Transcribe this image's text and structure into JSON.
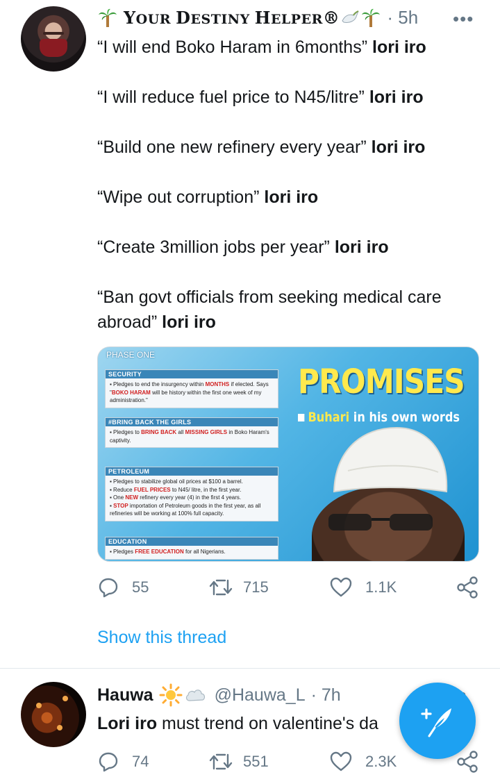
{
  "tweet1": {
    "display_name_parts": [
      {
        "big": "Y",
        "small": "OUR "
      },
      {
        "big": "D",
        "small": "ESTINY "
      },
      {
        "big": "H",
        "small": "ELPER"
      }
    ],
    "reg_mark": "®",
    "time": "· 5h",
    "more": "•••",
    "lines": [
      {
        "quote": "“I will end Boko Haram in 6months”",
        "tag": "lori iro"
      },
      {
        "quote": "“I will reduce fuel price to N45/litre”",
        "tag": "lori iro"
      },
      {
        "quote": "“Build one new refinery every year”",
        "tag": "lori iro"
      },
      {
        "quote": "“Wipe out corruption”",
        "tag": "lori iro"
      },
      {
        "quote": "“Create 3million jobs per year”",
        "tag": "lori iro"
      },
      {
        "quote": "“Ban govt officials from seeking medical care abroad”",
        "tag": "lori iro"
      }
    ],
    "media": {
      "phase": "PHASE ONE",
      "title": "PROMISES",
      "subtitle_name": "Buhari",
      "subtitle_rest": " in his own words",
      "panels": [
        {
          "heading": "SECURITY",
          "body": [
            {
              "t": "▪ Pledges to end the insurgency within "
            },
            {
              "t": "MONTHS",
              "red": true
            },
            {
              "t": " if elected. Says \""
            },
            {
              "t": "BOKO HARAM",
              "red": true
            },
            {
              "t": " will be history within the first one week of my administration.\""
            }
          ]
        },
        {
          "heading": "#BRING BACK THE GIRLS",
          "body": [
            {
              "t": "▪ Pledges to "
            },
            {
              "t": "BRING BACK",
              "red": true
            },
            {
              "t": " all "
            },
            {
              "t": "MISSING GIRLS",
              "red": true
            },
            {
              "t": " in Boko Haram's captivity."
            }
          ]
        },
        {
          "heading": "PETROLEUM",
          "body": [
            {
              "t": "▪ Pledges to stabilize global oil prices at $100 a barrel."
            },
            {
              "br": true
            },
            {
              "t": "▪ Reduce "
            },
            {
              "t": "FUEL PRICES",
              "red": true
            },
            {
              "t": " to N45/ litre, in the first year."
            },
            {
              "br": true
            },
            {
              "t": "▪ One "
            },
            {
              "t": "NEW",
              "red": true
            },
            {
              "t": " refinery every year (4) in the first 4 years."
            },
            {
              "br": true
            },
            {
              "t": "▪ "
            },
            {
              "t": "STOP",
              "red": true
            },
            {
              "t": " importation of Petroleum goods in the first year, as all refineries will be working at 100% full capacity."
            }
          ]
        },
        {
          "heading": "EDUCATION",
          "body": [
            {
              "t": "▪ Pledges "
            },
            {
              "t": "FREE EDUCATION",
              "red": true
            },
            {
              "t": " for all Nigerians."
            }
          ]
        }
      ]
    },
    "actions": {
      "replies": "55",
      "retweets": "715",
      "likes": "1.1K"
    },
    "show_thread": "Show this thread"
  },
  "tweet2": {
    "name": "Hauwa",
    "handle": "@Hauwa_L",
    "time": "· 7h",
    "more": "••",
    "text_tag": "Lori iro",
    "text_rest": " must trend on valentine's da",
    "actions": {
      "replies": "74",
      "retweets": "551",
      "likes": "2.3K"
    }
  },
  "colors": {
    "accent": "#1da1f2",
    "muted": "#657786",
    "text": "#14171a"
  },
  "icons": [
    "palm-tree-icon",
    "dove-icon",
    "reply-icon",
    "retweet-icon",
    "like-icon",
    "share-icon",
    "sun-icon",
    "cloud-icon",
    "compose-tweet-icon"
  ]
}
